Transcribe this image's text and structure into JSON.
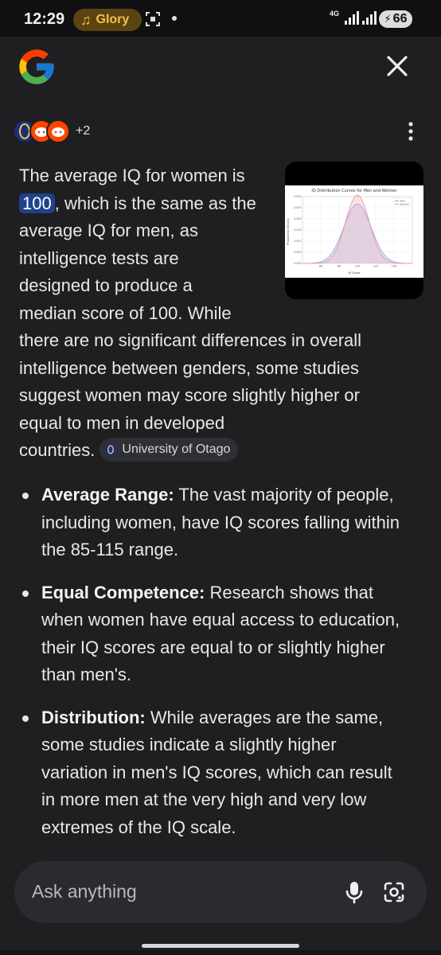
{
  "status_bar": {
    "time": "12:29",
    "media_title": "Glory",
    "network": "4G",
    "battery": "66"
  },
  "sources": {
    "more_count": "+2"
  },
  "answer": {
    "lines": [
      "The average IQ for women is",
      "100",
      ", which is the same as the",
      "average IQ for men, as",
      "intelligence tests are",
      "designed to produce a",
      "median score of 100. While",
      "there are no significant differences in overall",
      "intelligence between genders, some studies",
      "suggest women may score slightly higher or",
      "equal to men in developed",
      "countries."
    ],
    "citation": "University of Otago"
  },
  "chart_image": {
    "chart_data": {
      "type": "line",
      "title": "IQ Distribution Curves for Men and Women",
      "xlabel": "IQ Score",
      "ylabel": "Probability Density",
      "xlim": [
        40,
        160
      ],
      "ylim": [
        0,
        0.03
      ],
      "x_ticks": [
        "60",
        "80",
        "100",
        "120",
        "140"
      ],
      "y_ticks": [
        "0.000",
        "0.005",
        "0.010",
        "0.015",
        "0.020",
        "0.025",
        "0.030"
      ],
      "series": [
        {
          "name": "Men",
          "color": "#9aa8e8",
          "mean": 100,
          "sd": 15
        },
        {
          "name": "Women",
          "color": "#e79aa0",
          "mean": 100,
          "sd": 13
        }
      ],
      "legend": "top-right"
    }
  },
  "bullets": [
    {
      "title": "Average Range:",
      "lines": [
        "The vast majority of people,",
        "including women, have IQ scores falling within",
        "the 85-115 range."
      ]
    },
    {
      "title": "Equal Competence:",
      "lines": [
        "Research shows that",
        "when women have equal access to education,",
        "their IQ scores are equal to or slightly higher",
        "than men's."
      ]
    },
    {
      "title": "Distribution:",
      "lines": [
        "While averages are the same,",
        "some studies indicate a slightly higher",
        "variation in men's IQ scores, which can result",
        "in more men at the very high and very low",
        "extremes of the IQ scale."
      ]
    }
  ],
  "input": {
    "placeholder": "Ask anything"
  },
  "colors": {
    "background": "#1f1f21",
    "highlight": "#20418c",
    "input_bg": "#2a2b2e"
  },
  "icons": [
    "music-note-icon",
    "screenshot-icon",
    "signal-icon",
    "battery-icon",
    "google-logo",
    "close-icon",
    "more-vert-icon",
    "mic-icon",
    "lens-icon"
  ]
}
